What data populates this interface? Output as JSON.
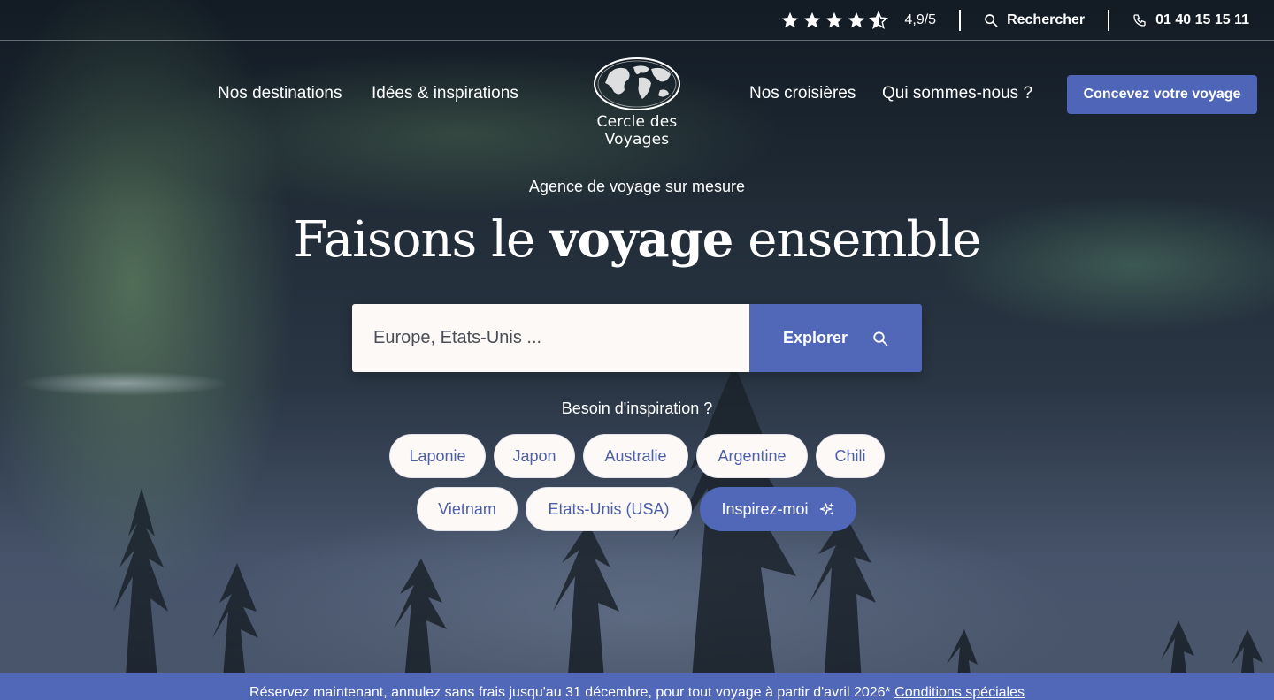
{
  "topbar": {
    "rating_value": "4,9/5",
    "stars": 4.5,
    "search_label": "Rechercher",
    "phone": "01 40 15 15 11"
  },
  "nav": {
    "destinations": "Nos destinations",
    "ideas": "Idées & inspirations",
    "cruises": "Nos croisières",
    "about": "Qui sommes-nous ?",
    "brand": "Cercle des Voyages",
    "cta": "Concevez votre voyage"
  },
  "hero": {
    "subtitle": "Agence de voyage sur mesure",
    "headline_start": "Faisons le ",
    "headline_bold": "voyage",
    "headline_end": " ensemble"
  },
  "search": {
    "placeholder": "Europe, Etats-Unis ...",
    "button": "Explorer"
  },
  "inspiration": {
    "label": "Besoin d'inspiration ?",
    "chips": [
      "Laponie",
      "Japon",
      "Australie",
      "Argentine",
      "Chili",
      "Vietnam",
      "Etats-Unis (USA)"
    ],
    "cta": "Inspirez-moi"
  },
  "banner": {
    "text": "Réservez maintenant, annulez sans frais jusqu'au 31 décembre, pour tout voyage à partir d'avril 2026* ",
    "link": "Conditions spéciales"
  },
  "colors": {
    "accent": "#5168b9",
    "chip_bg": "#fdf9f7",
    "chip_text": "#4c5fa8"
  }
}
